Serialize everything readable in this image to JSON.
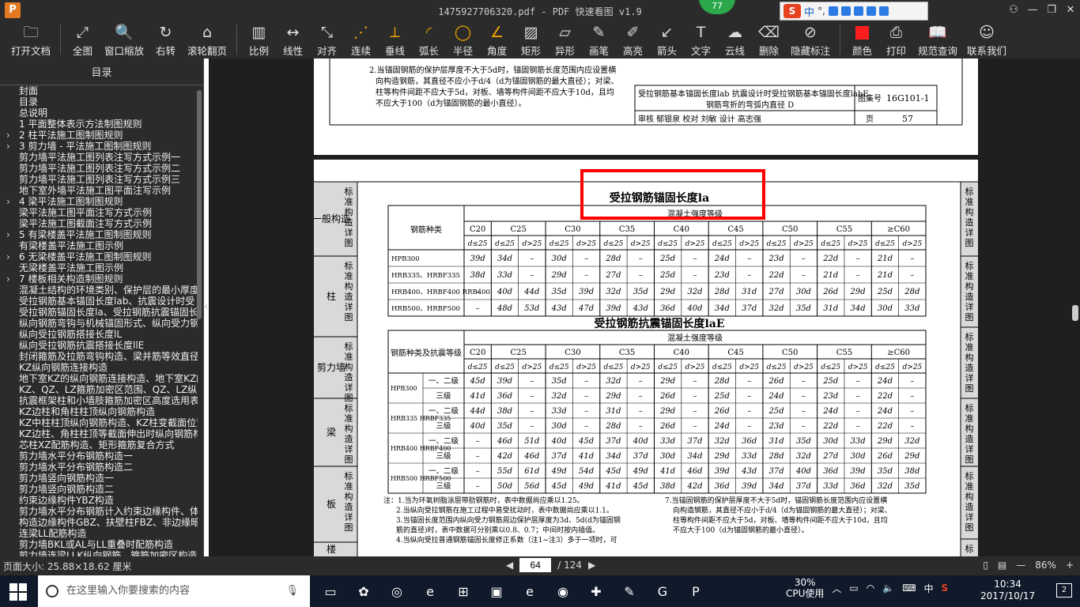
{
  "window": {
    "app_icon": "P",
    "title": "1475927706320.pdf - PDF 快速看图 v1.9",
    "badge": "77",
    "ime_cn": "中",
    "controls": [
      "□",
      "—",
      "□",
      "✕"
    ]
  },
  "toolbar": [
    {
      "name": "open-file",
      "label": "打开文档",
      "icon": "folder-icon",
      "glyph": "🗀"
    },
    {
      "name": "fit-page",
      "label": "全图",
      "icon": "expand-icon",
      "glyph": "⤢"
    },
    {
      "name": "window-zoom",
      "label": "窗口缩放",
      "icon": "magnifier-icon",
      "glyph": "🔍"
    },
    {
      "name": "rotate-right",
      "label": "右转",
      "icon": "rotate-icon",
      "glyph": "↻"
    },
    {
      "name": "scroll-page",
      "label": "滚轮翻页",
      "icon": "mouse-icon",
      "glyph": "⌂"
    },
    {
      "name": "scale",
      "label": "比例",
      "icon": "ruler-icon",
      "glyph": "▥"
    },
    {
      "name": "linear",
      "label": "线性",
      "icon": "linear-icon",
      "glyph": "↔"
    },
    {
      "name": "align",
      "label": "对齐",
      "icon": "align-icon",
      "glyph": "⤡"
    },
    {
      "name": "continuous",
      "label": "连续",
      "icon": "continuous-icon",
      "glyph": "⋰",
      "orange": true
    },
    {
      "name": "perpendicular",
      "label": "垂线",
      "icon": "perpendicular-icon",
      "glyph": "⟂",
      "orange": true
    },
    {
      "name": "arc-length",
      "label": "弧长",
      "icon": "arc-icon",
      "glyph": "◜",
      "orange": true
    },
    {
      "name": "radius",
      "label": "半径",
      "icon": "radius-icon",
      "glyph": "◯",
      "orange": true
    },
    {
      "name": "angle",
      "label": "角度",
      "icon": "angle-icon",
      "glyph": "∠",
      "orange": true
    },
    {
      "name": "rectangle",
      "label": "矩形",
      "icon": "rect-icon",
      "glyph": "▨"
    },
    {
      "name": "irregular",
      "label": "异形",
      "icon": "irregular-icon",
      "glyph": "▱"
    },
    {
      "name": "pen",
      "label": "画笔",
      "icon": "pen-icon",
      "glyph": "✎"
    },
    {
      "name": "highlight",
      "label": "高亮",
      "icon": "highlight-icon",
      "glyph": "✐"
    },
    {
      "name": "arrow",
      "label": "箭头",
      "icon": "arrow-icon",
      "glyph": "↙"
    },
    {
      "name": "text",
      "label": "文字",
      "icon": "text-icon",
      "glyph": "T"
    },
    {
      "name": "cloud-line",
      "label": "云线",
      "icon": "cloud-icon",
      "glyph": "☁"
    },
    {
      "name": "delete",
      "label": "删除",
      "icon": "eraser-icon",
      "glyph": "⌫"
    },
    {
      "name": "hide-marks",
      "label": "隐藏标注",
      "icon": "eye-off-icon",
      "glyph": "⊘"
    },
    {
      "name": "color",
      "label": "颜色",
      "icon": "color-swatch-icon",
      "glyph": "",
      "swatch": "#ff1d1d"
    },
    {
      "name": "print",
      "label": "打印",
      "icon": "printer-icon",
      "glyph": "⎙"
    },
    {
      "name": "spec-lookup",
      "label": "规范查询",
      "icon": "book-icon",
      "glyph": "📖"
    },
    {
      "name": "contact-us",
      "label": "联系我们",
      "icon": "chat-icon",
      "glyph": "☺"
    }
  ],
  "sidebar": {
    "heading": "目录",
    "items": [
      {
        "label": "封面",
        "arrow": false
      },
      {
        "label": "目录",
        "arrow": false
      },
      {
        "label": "总说明",
        "arrow": false
      },
      {
        "label": "1 平面整体表示方法制图规则",
        "arrow": false
      },
      {
        "label": "2 柱平法施工图制图规则",
        "arrow": true
      },
      {
        "label": "3 剪力墙 - 平法施工图制图规则",
        "arrow": true
      },
      {
        "label": "剪力墙平法施工图列表注写方式示例一",
        "arrow": false
      },
      {
        "label": "剪力墙平法施工图列表注写方式示例二",
        "arrow": false
      },
      {
        "label": "剪力墙平法施工图列表注写方式示例三",
        "arrow": false
      },
      {
        "label": "地下室外墙平法施工图平面注写示例",
        "arrow": false
      },
      {
        "label": "4 梁平法施工图制图规则",
        "arrow": true
      },
      {
        "label": "梁平法施工图平面注写方式示例",
        "arrow": false
      },
      {
        "label": "梁平法施工图截面注写方式示例",
        "arrow": false
      },
      {
        "label": "5 有梁楼盖平法施工图制图规则",
        "arrow": true
      },
      {
        "label": "有梁楼盖平法施工图示例",
        "arrow": false
      },
      {
        "label": "6 无梁楼盖平法施工图制图规则",
        "arrow": true
      },
      {
        "label": "无梁楼盖平法施工图示例",
        "arrow": false
      },
      {
        "label": "7 楼板相关构造制图规则",
        "arrow": true
      },
      {
        "label": "混凝土结构的环境类别、保护层的最小厚度",
        "arrow": false
      },
      {
        "label": "受拉钢筋基本锚固长度lab、抗震设计时受",
        "arrow": false
      },
      {
        "label": "受拉钢筋锚固长度la、受拉钢筋抗震锚固长",
        "arrow": false
      },
      {
        "label": "纵向钢筋弯钩与机械锚固形式、纵向受力钢",
        "arrow": false
      },
      {
        "label": "纵向受拉钢筋搭接长度lL",
        "arrow": false
      },
      {
        "label": "纵向受拉钢筋抗震搭接长度llE",
        "arrow": false
      },
      {
        "label": "封闭箍筋及拉筋弯钩构造、梁并筋等效直径",
        "arrow": false
      },
      {
        "label": "KZ纵向钢筋连接构造",
        "arrow": false
      },
      {
        "label": "地下室KZ的纵向钢筋连接构造、地下室KZ的",
        "arrow": false
      },
      {
        "label": "KZ、QZ、LZ箍筋加密区范围、QZ、LZ纵向钢",
        "arrow": false
      },
      {
        "label": "抗震框架柱和小墙肢箍筋加密区高度选用表",
        "arrow": false
      },
      {
        "label": "KZ边柱和角柱柱顶纵向钢筋构造",
        "arrow": false
      },
      {
        "label": "KZ中柱柱顶纵向钢筋构造、KZ柱变截面位置",
        "arrow": false
      },
      {
        "label": "KZ边柱、角柱柱顶等截面伸出时纵向钢筋构",
        "arrow": false
      },
      {
        "label": "芯柱XZ配筋构造、矩形箍筋复合方式",
        "arrow": false
      },
      {
        "label": "剪力墙水平分布钢筋构造一",
        "arrow": false
      },
      {
        "label": "剪力墙水平分布钢筋构造二",
        "arrow": false
      },
      {
        "label": "剪力墙竖向钢筋构造一",
        "arrow": false
      },
      {
        "label": "剪力墙竖向钢筋构造二",
        "arrow": false
      },
      {
        "label": "约束边缘构件YBZ构造",
        "arrow": false
      },
      {
        "label": "剪力墙水平分布钢筋计入约束边缘构件、体",
        "arrow": false
      },
      {
        "label": "构造边缘构件GBZ、扶壁柱FBZ、非边缘暗柱",
        "arrow": false
      },
      {
        "label": "连梁LL配筋构造",
        "arrow": false
      },
      {
        "label": "剪力墙BKL或AL与LL重叠时配筋构造",
        "arrow": false
      },
      {
        "label": "剪力墙连梁LLK纵向钢筋、箍筋加密区构造",
        "arrow": false
      }
    ]
  },
  "page_top": {
    "left_col": "标准构造详图",
    "right_col": "楼板相关构造",
    "note_2a": "2.当锚固钢筋的保护层厚度不大于5d时，锚固钢筋长度范围内应设置横",
    "note_2b": "向构造钢筋，其直径不应小于d/4（d为锚固钢筋的最大直径）；对梁、",
    "note_2c": "柱等构件间距不应大于5d，对板、墙等构件间距不应大于10d，且均",
    "note_2d": "不应大于100（d为锚固钢筋的最小直径）。",
    "title_a": "受拉钢筋基本锚固长度lab  抗震设计时受拉钢筋基本锚固长度labE",
    "title_b": "钢筋弯折的弯弧内直径 D",
    "atlas_label": "图集号",
    "atlas_no": "16G101-1",
    "review_row": "审核 郁银泉 校对 刘敏 设计 高志强",
    "page_label": "页",
    "page_no": "57"
  },
  "page_main": {
    "left_sections": [
      "一般构造",
      "柱",
      "剪力墙",
      "梁",
      "板",
      "楼"
    ],
    "left_tag": "标准构造详图",
    "right_sections": [
      "标准构造详图",
      "标准构造详图",
      "标准构造详图",
      "标准构造详图",
      "标准构造详图",
      "标"
    ],
    "table1_title": "受拉钢筋锚固长度la",
    "table1_header": "混凝土强度等级",
    "table1_rowhead": "钢筋种类",
    "grades": [
      "C20",
      "C25",
      "C30",
      "C35",
      "C40",
      "C45",
      "C50",
      "C55",
      "≥C60"
    ],
    "sub_c20": "d≤25",
    "sub_le": "d≤25",
    "sub_gt": "d>25",
    "table1_rows": [
      {
        "type": "HPB300",
        "cells": [
          "39d",
          "34d",
          "–",
          "30d",
          "–",
          "28d",
          "–",
          "25d",
          "–",
          "24d",
          "–",
          "23d",
          "–",
          "22d",
          "–",
          "21d",
          "–"
        ]
      },
      {
        "type": "HRB335、HRBF335",
        "cells": [
          "38d",
          "33d",
          "–",
          "29d",
          "–",
          "27d",
          "–",
          "25d",
          "–",
          "23d",
          "–",
          "22d",
          "–",
          "21d",
          "–",
          "21d",
          "–"
        ]
      },
      {
        "type": "HRB400、HRBF400 RRB400",
        "cells": [
          "–",
          "40d",
          "44d",
          "35d",
          "39d",
          "32d",
          "35d",
          "29d",
          "32d",
          "28d",
          "31d",
          "27d",
          "30d",
          "26d",
          "29d",
          "25d",
          "28d"
        ]
      },
      {
        "type": "HRB500、HRBF500",
        "cells": [
          "–",
          "48d",
          "53d",
          "43d",
          "47d",
          "39d",
          "43d",
          "36d",
          "40d",
          "34d",
          "37d",
          "32d",
          "35d",
          "31d",
          "34d",
          "30d",
          "33d"
        ]
      }
    ],
    "table2_title": "受拉钢筋抗震锚固长度laE",
    "table2_rowhead": "钢筋种类及抗震等级",
    "table2_rows": [
      {
        "type": "HPB300",
        "grade": "一、二级",
        "cells": [
          "45d",
          "39d",
          "–",
          "35d",
          "–",
          "32d",
          "–",
          "29d",
          "–",
          "28d",
          "–",
          "26d",
          "–",
          "25d",
          "–",
          "24d",
          "–"
        ]
      },
      {
        "type": "",
        "grade": "三级",
        "cells": [
          "41d",
          "36d",
          "–",
          "32d",
          "–",
          "29d",
          "–",
          "26d",
          "–",
          "25d",
          "–",
          "24d",
          "–",
          "23d",
          "–",
          "22d",
          "–"
        ]
      },
      {
        "type": "HRB335 HRBF335",
        "grade": "一、二级",
        "cells": [
          "44d",
          "38d",
          "–",
          "33d",
          "–",
          "31d",
          "–",
          "29d",
          "–",
          "26d",
          "–",
          "25d",
          "–",
          "24d",
          "–",
          "24d",
          "–"
        ]
      },
      {
        "type": "",
        "grade": "三级",
        "cells": [
          "40d",
          "35d",
          "–",
          "30d",
          "–",
          "28d",
          "–",
          "26d",
          "–",
          "24d",
          "–",
          "23d",
          "–",
          "22d",
          "–",
          "22d",
          "–"
        ]
      },
      {
        "type": "HRB400 HRBF400",
        "grade": "一、二级",
        "cells": [
          "–",
          "46d",
          "51d",
          "40d",
          "45d",
          "37d",
          "40d",
          "33d",
          "37d",
          "32d",
          "36d",
          "31d",
          "35d",
          "30d",
          "33d",
          "29d",
          "32d"
        ]
      },
      {
        "type": "",
        "grade": "三级",
        "cells": [
          "–",
          "42d",
          "46d",
          "37d",
          "41d",
          "34d",
          "37d",
          "30d",
          "34d",
          "29d",
          "33d",
          "28d",
          "32d",
          "27d",
          "30d",
          "26d",
          "29d"
        ]
      },
      {
        "type": "HRB500 HRBF500",
        "grade": "一、二级",
        "cells": [
          "–",
          "55d",
          "61d",
          "49d",
          "54d",
          "45d",
          "49d",
          "41d",
          "46d",
          "39d",
          "43d",
          "37d",
          "40d",
          "36d",
          "39d",
          "35d",
          "38d"
        ]
      },
      {
        "type": "",
        "grade": "三级",
        "cells": [
          "–",
          "50d",
          "56d",
          "45d",
          "49d",
          "41d",
          "45d",
          "38d",
          "42d",
          "36d",
          "39d",
          "34d",
          "37d",
          "33d",
          "36d",
          "32d",
          "35d"
        ]
      }
    ],
    "notes_left": [
      "注：1.当为环氧树脂涂层带肋钢筋时，表中数据尚应乘以1.25。",
      "2.当纵向受拉钢筋在施工过程中易受扰动时，表中数据尚应乘以1.1。",
      "3.当锚固长度范围内纵向受力钢筋周边保护层厚度为3d、5d(d为锚固钢",
      "筋的直径)时，表中数据可分别乘以0.8、0.7；中间时按内插值。",
      "4.当纵向受拉普通钢筋锚固长度修正系数（注1~注3）多于一项时，可"
    ],
    "notes_right": [
      "7.当锚固钢筋的保护层厚度不大于5d时，锚固钢筋长度范围内应设置横",
      "向构造钢筋，其直径不应小于d/4（d为锚固钢筋的最大直径）；对梁、",
      "柱等构件间距不应大于5d，对板、墙等构件间距不应大于10d，且均",
      "不应大于100（d为锚固钢筋的最小直径）。"
    ],
    "highlight_color": "#ff0000"
  },
  "status": {
    "page_size": "页面大小: 25.88×18.62 厘米",
    "current_page": "64",
    "total_pages": "/ 124",
    "zoom": "86%",
    "prev": "◀",
    "next": "▶"
  },
  "taskbar": {
    "search_placeholder": "在这里输入你要搜索的内容",
    "apps": [
      "▭",
      "✿",
      "◎",
      "e",
      "⊞",
      "▣",
      "e",
      "◉",
      "✚",
      "✎",
      "G",
      "P"
    ],
    "cpu_pct": "30%",
    "cpu_label": "CPU使用",
    "lang": "中",
    "time": "10:34",
    "date": "2017/10/17",
    "notif_count": "2"
  }
}
